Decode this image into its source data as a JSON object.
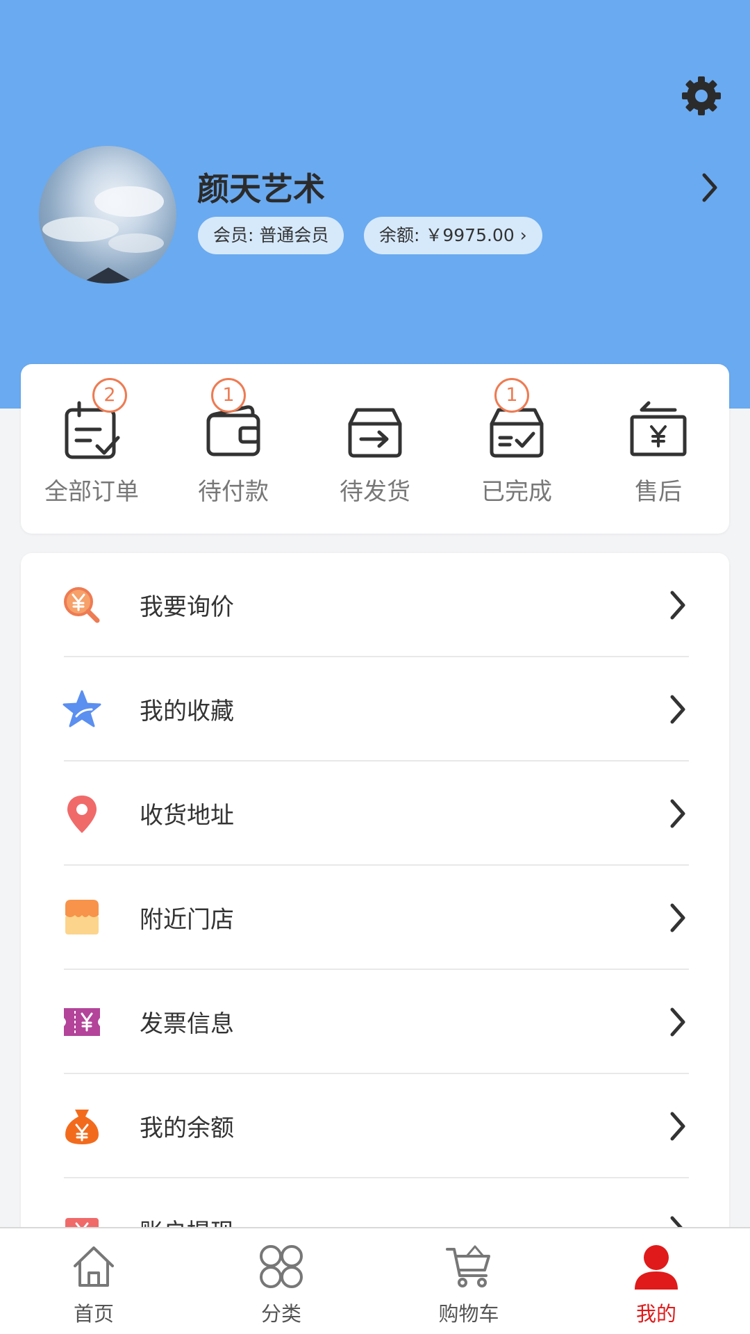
{
  "profile": {
    "name": "颜天艺术",
    "member_label": "会员: 普通会员",
    "balance_label": "余额: ￥9975.00 ›"
  },
  "orders": [
    {
      "label": "全部订单",
      "badge": "2",
      "icon": "calendar-check-icon"
    },
    {
      "label": "待付款",
      "badge": "1",
      "icon": "wallet-icon"
    },
    {
      "label": "待发货",
      "badge": "",
      "icon": "box-arrow-icon"
    },
    {
      "label": "已完成",
      "badge": "1",
      "icon": "box-check-icon"
    },
    {
      "label": "售后",
      "badge": "",
      "icon": "refund-yen-icon"
    }
  ],
  "menu": [
    {
      "label": "我要询价",
      "icon": "price-inquiry-icon"
    },
    {
      "label": "我的收藏",
      "icon": "star-icon"
    },
    {
      "label": "收货地址",
      "icon": "location-pin-icon"
    },
    {
      "label": "附近门店",
      "icon": "store-icon"
    },
    {
      "label": "发票信息",
      "icon": "invoice-ticket-icon"
    },
    {
      "label": "我的余额",
      "icon": "money-bag-icon"
    },
    {
      "label": "账户提现",
      "icon": "withdraw-icon"
    }
  ],
  "nav": [
    {
      "label": "首页",
      "icon": "home-icon"
    },
    {
      "label": "分类",
      "icon": "category-icon"
    },
    {
      "label": "购物车",
      "icon": "cart-icon"
    },
    {
      "label": "我的",
      "icon": "user-icon",
      "active": true
    }
  ],
  "colors": {
    "header": "#6aaaf0",
    "badge": "#ee7b52",
    "active": "#e01a1a"
  }
}
